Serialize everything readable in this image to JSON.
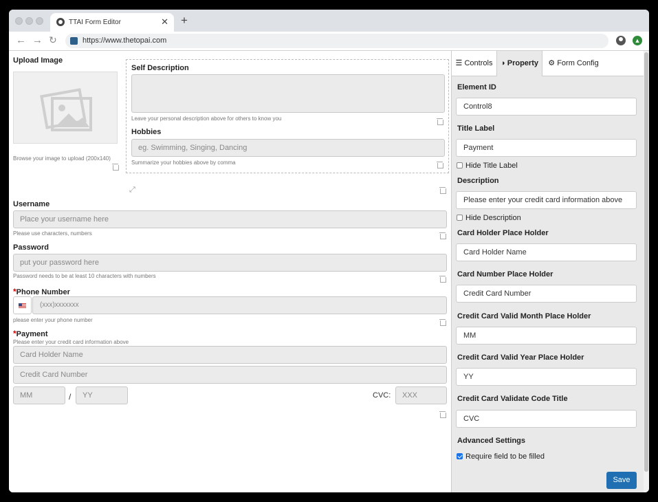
{
  "browser": {
    "tab_title": "TTAI Form Editor",
    "tab_close": "✕",
    "new_tab": "+",
    "url": "https://www.thetopai.com"
  },
  "form": {
    "upload": {
      "label": "Upload Image",
      "help": "Browse your image to upload (200x140)"
    },
    "self_description": {
      "label": "Self Description",
      "help": "Leave your personal description above for others to know you"
    },
    "hobbies": {
      "label": "Hobbies",
      "placeholder": "eg. Swimming, Singing, Dancing",
      "help": "Summarize your hobbies above by comma"
    },
    "username": {
      "label": "Username",
      "placeholder": "Place your username here",
      "help": "Please use characters, numbers"
    },
    "password": {
      "label": "Password",
      "placeholder": "put your password here",
      "help": "Password needs to be at least 10 characters with numbers"
    },
    "phone": {
      "required_mark": "*",
      "label": "Phone Number",
      "placeholder": "(xxx)xxxxxxx",
      "help": "please enter your phone number"
    },
    "payment": {
      "required_mark": "*",
      "label": "Payment",
      "help": "Please enter your credit card information above",
      "holder_placeholder": "Card Holder Name",
      "number_placeholder": "Credit Card Number",
      "month_placeholder": "MM",
      "separator": "/",
      "year_placeholder": "YY",
      "cvc_label": "CVC:",
      "cvc_placeholder": "XXX"
    }
  },
  "panel": {
    "tabs": [
      "Controls",
      "Property",
      "Form Config"
    ],
    "active_tab": "Property",
    "element_id_label": "Element ID",
    "element_id_value": "Control8",
    "title_label_label": "Title Label",
    "title_label_value": "Payment",
    "hide_title_label": "Hide Title Label",
    "hide_title_checked": false,
    "description_label": "Description",
    "description_value": "Please enter your credit card information above",
    "hide_description": "Hide Description",
    "hide_description_checked": false,
    "holder_ph_label": "Card Holder Place Holder",
    "holder_ph_value": "Card Holder Name",
    "number_ph_label": "Card Number Place Holder",
    "number_ph_value": "Credit Card Number",
    "month_ph_label": "Credit Card Valid Month Place Holder",
    "month_ph_value": "MM",
    "year_ph_label": "Credit Card Valid Year Place Holder",
    "year_ph_value": "YY",
    "code_title_label": "Credit Card Validate Code Title",
    "code_title_value": "CVC",
    "advanced_label": "Advanced Settings",
    "require_label": "Require field to be filled",
    "require_checked": true,
    "save_label": "Save"
  },
  "colors": {
    "accent": "#1f6fb2",
    "required": "#dd0000",
    "panel_bg": "#e9e9e9"
  }
}
